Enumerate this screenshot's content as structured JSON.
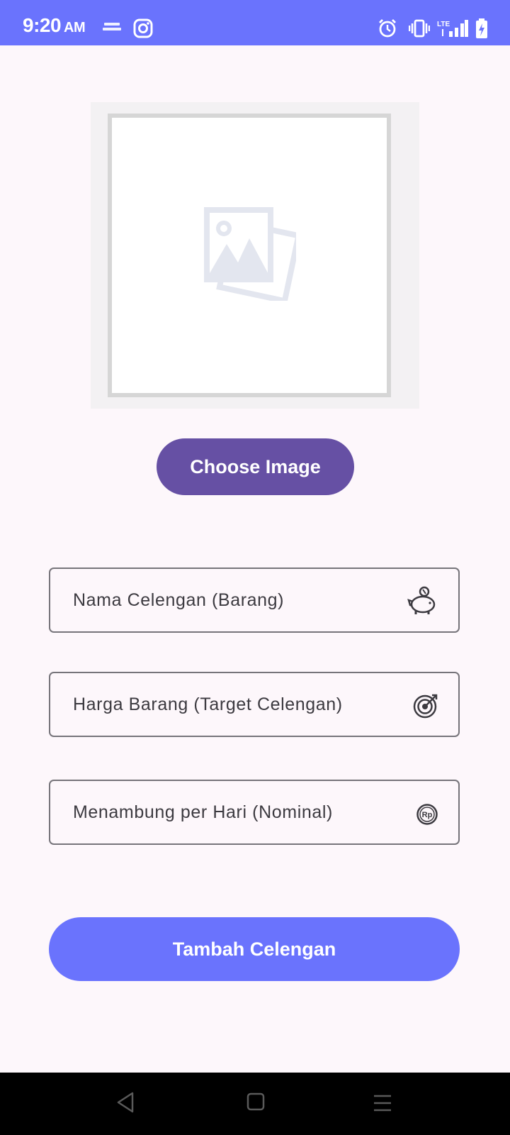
{
  "status_bar": {
    "time": "9:20",
    "ampm": "AM",
    "icons": [
      "grab-merchant-icon",
      "instagram-icon",
      "alarm-icon",
      "vibrate-icon",
      "lte-signal-icon",
      "battery-charging-icon"
    ],
    "network_label": "LTE",
    "color": "#6a73fd"
  },
  "image_preview": {
    "icon": "image-placeholder-icon"
  },
  "choose_image_button": {
    "label": "Choose Image",
    "color": "#6650a4"
  },
  "form": {
    "fields": [
      {
        "placeholder": "Nama Celengan (Barang)",
        "icon": "piggy-bank-icon"
      },
      {
        "placeholder": "Harga Barang (Target Celengan)",
        "icon": "target-icon"
      },
      {
        "placeholder": "Menambung per Hari (Nominal)",
        "icon": "rupiah-coin-icon"
      }
    ]
  },
  "submit_button": {
    "label": "Tambah Celengan",
    "color": "#6a73fd"
  },
  "nav_bar": {
    "buttons": [
      "back-icon",
      "home-icon",
      "menu-icon"
    ]
  }
}
